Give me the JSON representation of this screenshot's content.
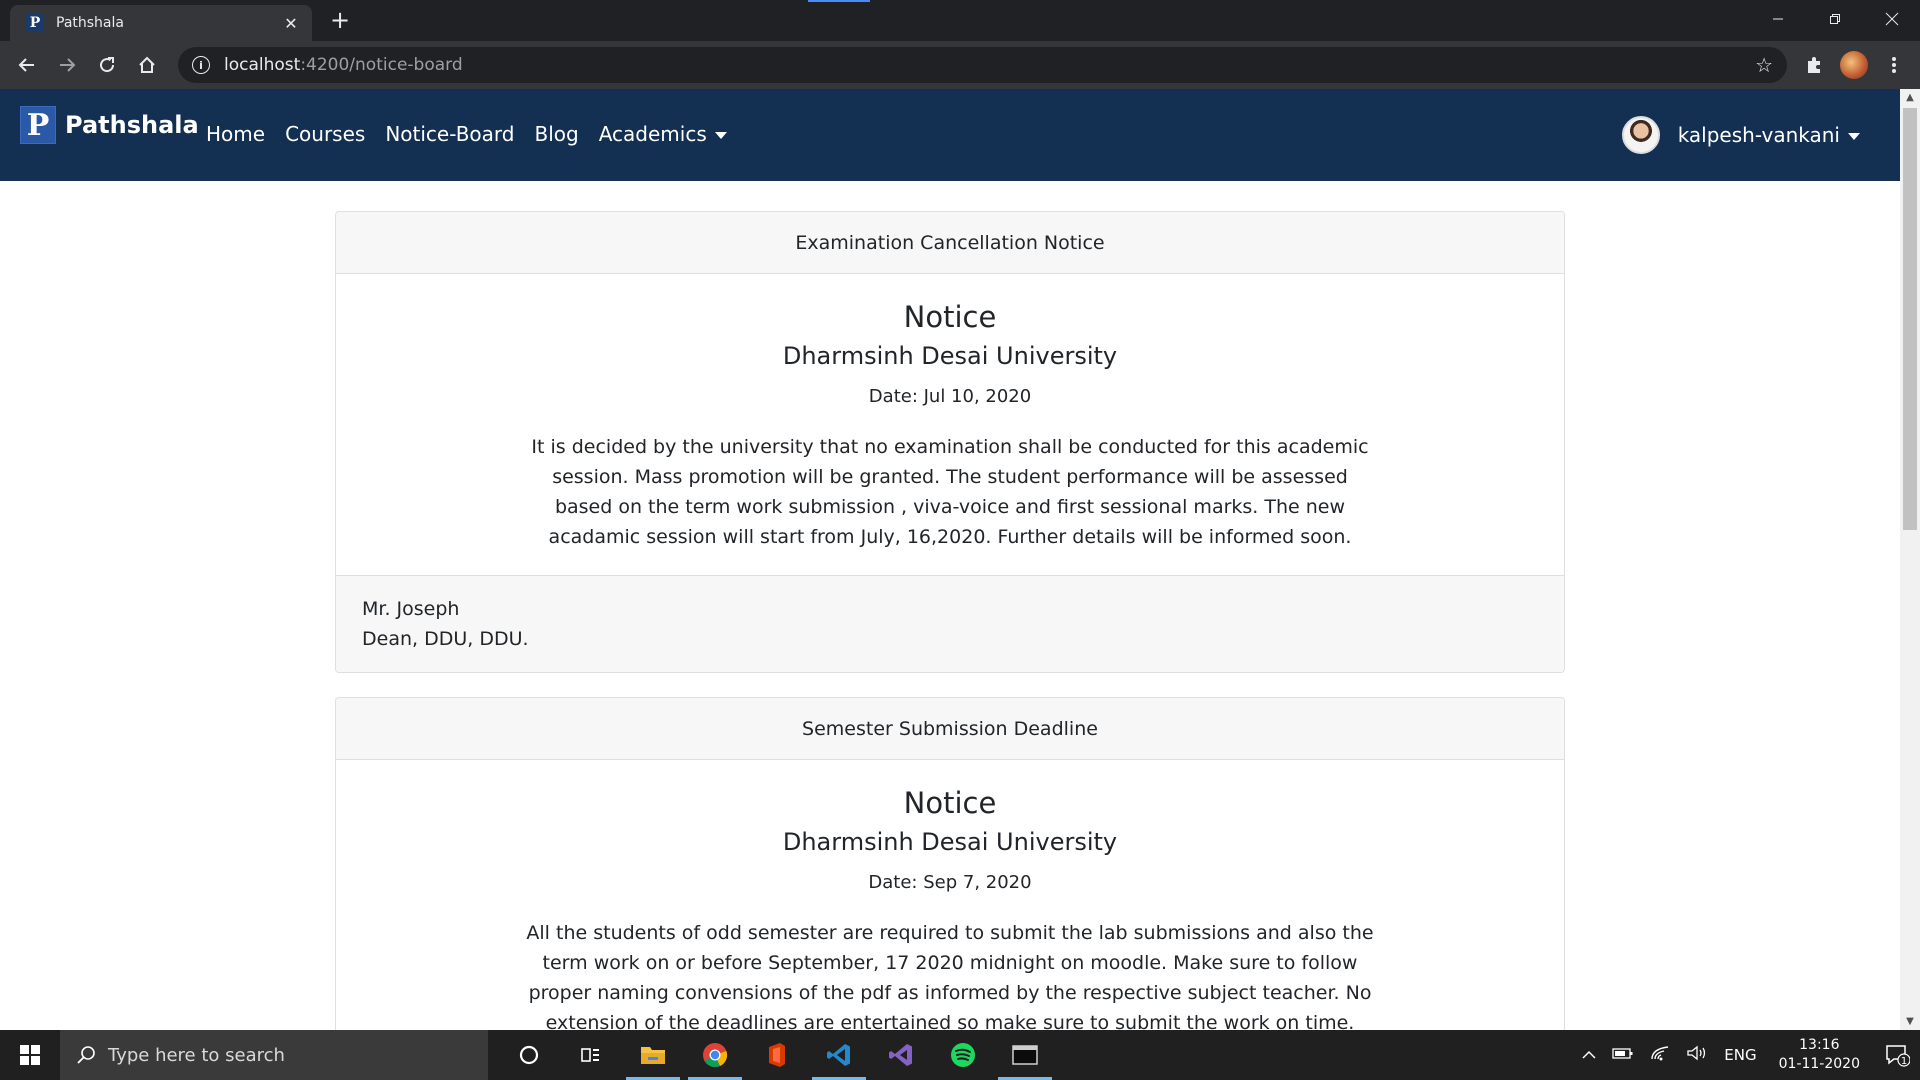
{
  "browser": {
    "tab_title": "Pathshala",
    "url_host": "localhost",
    "url_path": ":4200/notice-board"
  },
  "navbar": {
    "brand_letter": "P",
    "brand_name": "Pathshala",
    "links": [
      "Home",
      "Courses",
      "Notice-Board",
      "Blog",
      "Academics"
    ],
    "user_name": "kalpesh-vankani"
  },
  "notices": [
    {
      "header": "Examination Cancellation Notice",
      "title": "Notice",
      "org": "Dharmsinh Desai University",
      "date": "Date: Jul 10, 2020",
      "text": "It is decided by the university that no examination shall be conducted for this academic session. Mass promotion will be granted. The student performance will be assessed based on the term work submission , viva-voice and first sessional marks. The new acadamic session will start from July, 16,2020. Further details will be informed soon.",
      "signer_name": "Mr. Joseph",
      "signer_title": "Dean, DDU, DDU."
    },
    {
      "header": "Semester Submission Deadline",
      "title": "Notice",
      "org": "Dharmsinh Desai University",
      "date": "Date: Sep 7, 2020",
      "text": "All the students of odd semester are required to submit the lab submissions and also the term work on or before September, 17 2020 midnight on moodle. Make sure to follow proper naming convensions of the pdf as informed by the respective subject teacher. No extension of the deadlines are entertained so make sure to submit the work on time."
    }
  ],
  "taskbar": {
    "search_placeholder": "Type here to search",
    "language": "ENG",
    "time": "13:16",
    "date": "01-11-2020",
    "notification_count": "1"
  },
  "colors": {
    "navbar": "#132f52",
    "chrome_dark": "#202124",
    "chrome_toolbar": "#35363a"
  }
}
